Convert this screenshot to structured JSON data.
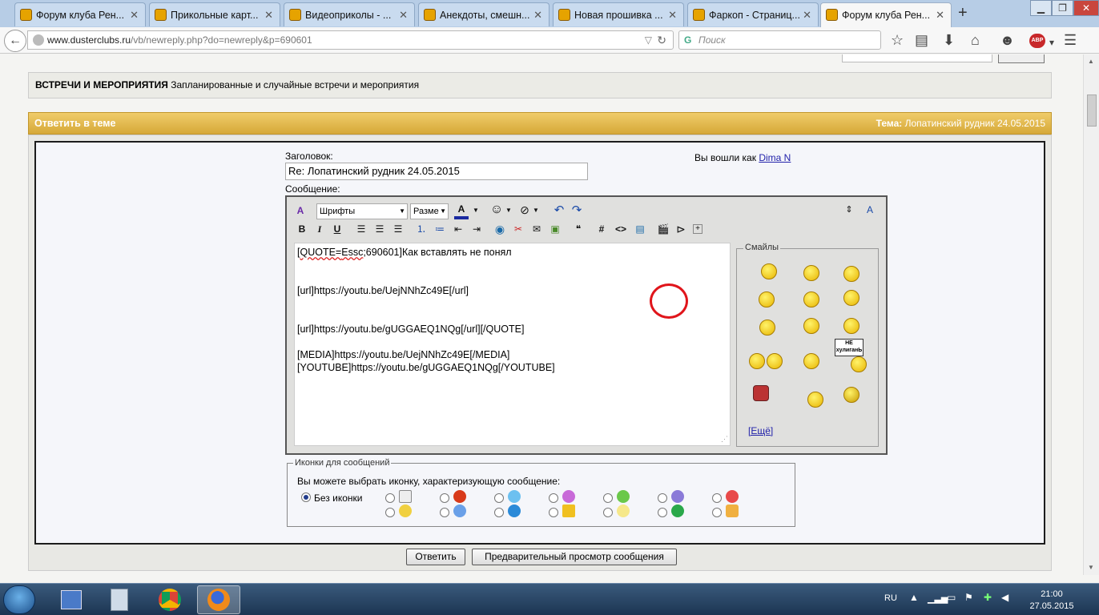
{
  "tabs": [
    {
      "title": "Форум клуба Рен..."
    },
    {
      "title": "Прикольные карт..."
    },
    {
      "title": "Видеоприколы - ..."
    },
    {
      "title": "Анекдоты, смешн..."
    },
    {
      "title": "Новая прошивка ..."
    },
    {
      "title": "Фаркоп - Страниц..."
    },
    {
      "title": "Форум клуба Рен..."
    }
  ],
  "url": {
    "host": "www.dusterclubs.ru",
    "path": "/vb/newreply.php?do=newreply&p=690601"
  },
  "search_placeholder": "Поиск",
  "category": {
    "title": "ВСТРЕЧИ И МЕРОПРИЯТИЯ",
    "desc": "Запланированные и случайные встречи и мероприятия"
  },
  "header": {
    "title": "Ответить в теме",
    "topic_label": "Тема:",
    "topic": "Лопатинский рудник 24.05.2015"
  },
  "form": {
    "subject_label": "Заголовок:",
    "subject_value": "Re: Лопатинский рудник 24.05.2015",
    "logged_in": "Вы вошли как",
    "user": "Dima N",
    "message_label": "Сообщение:"
  },
  "toolbar": {
    "font_select": "Шрифты",
    "size_select": "Разме",
    "bold": "B",
    "italic": "I",
    "underline": "U",
    "hash": "#",
    "code": "<>"
  },
  "message": {
    "line1_pre": "[",
    "line1_quote": "QUOTE=",
    "line1_user": "Essc",
    "line1_rest": ";690601]Как вставлять не понял",
    "line2": "[url]https://youtu.be/UejNNhZc49E[/url]",
    "line3": "[url]https://youtu.be/gUGGAEQ1NQg[/url][/QUOTE]",
    "line4": "[MEDIA]https://youtu.be/UejNNhZc49E[/MEDIA]",
    "line5": "[YOUTUBE]https://youtu.be/gUGGAEQ1NQg[/YOUTUBE]"
  },
  "smilies": {
    "title": "Смайлы",
    "more": "[Ещё]",
    "sign_text": "НЕ хулиганЬ"
  },
  "post_icons": {
    "title": "Иконки для сообщений",
    "prompt": "Вы можете выбрать иконку, характеризующую сообщение:",
    "no_icon": "Без иконки"
  },
  "buttons": {
    "submit": "Ответить",
    "preview": "Предварительный просмотр сообщения"
  },
  "taskbar": {
    "lang": "RU",
    "time": "21:00",
    "date": "27.05.2015"
  },
  "colors": {
    "header_gold": "#d6a838",
    "highlight_red": "#e0151b",
    "link": "#2222aa"
  }
}
